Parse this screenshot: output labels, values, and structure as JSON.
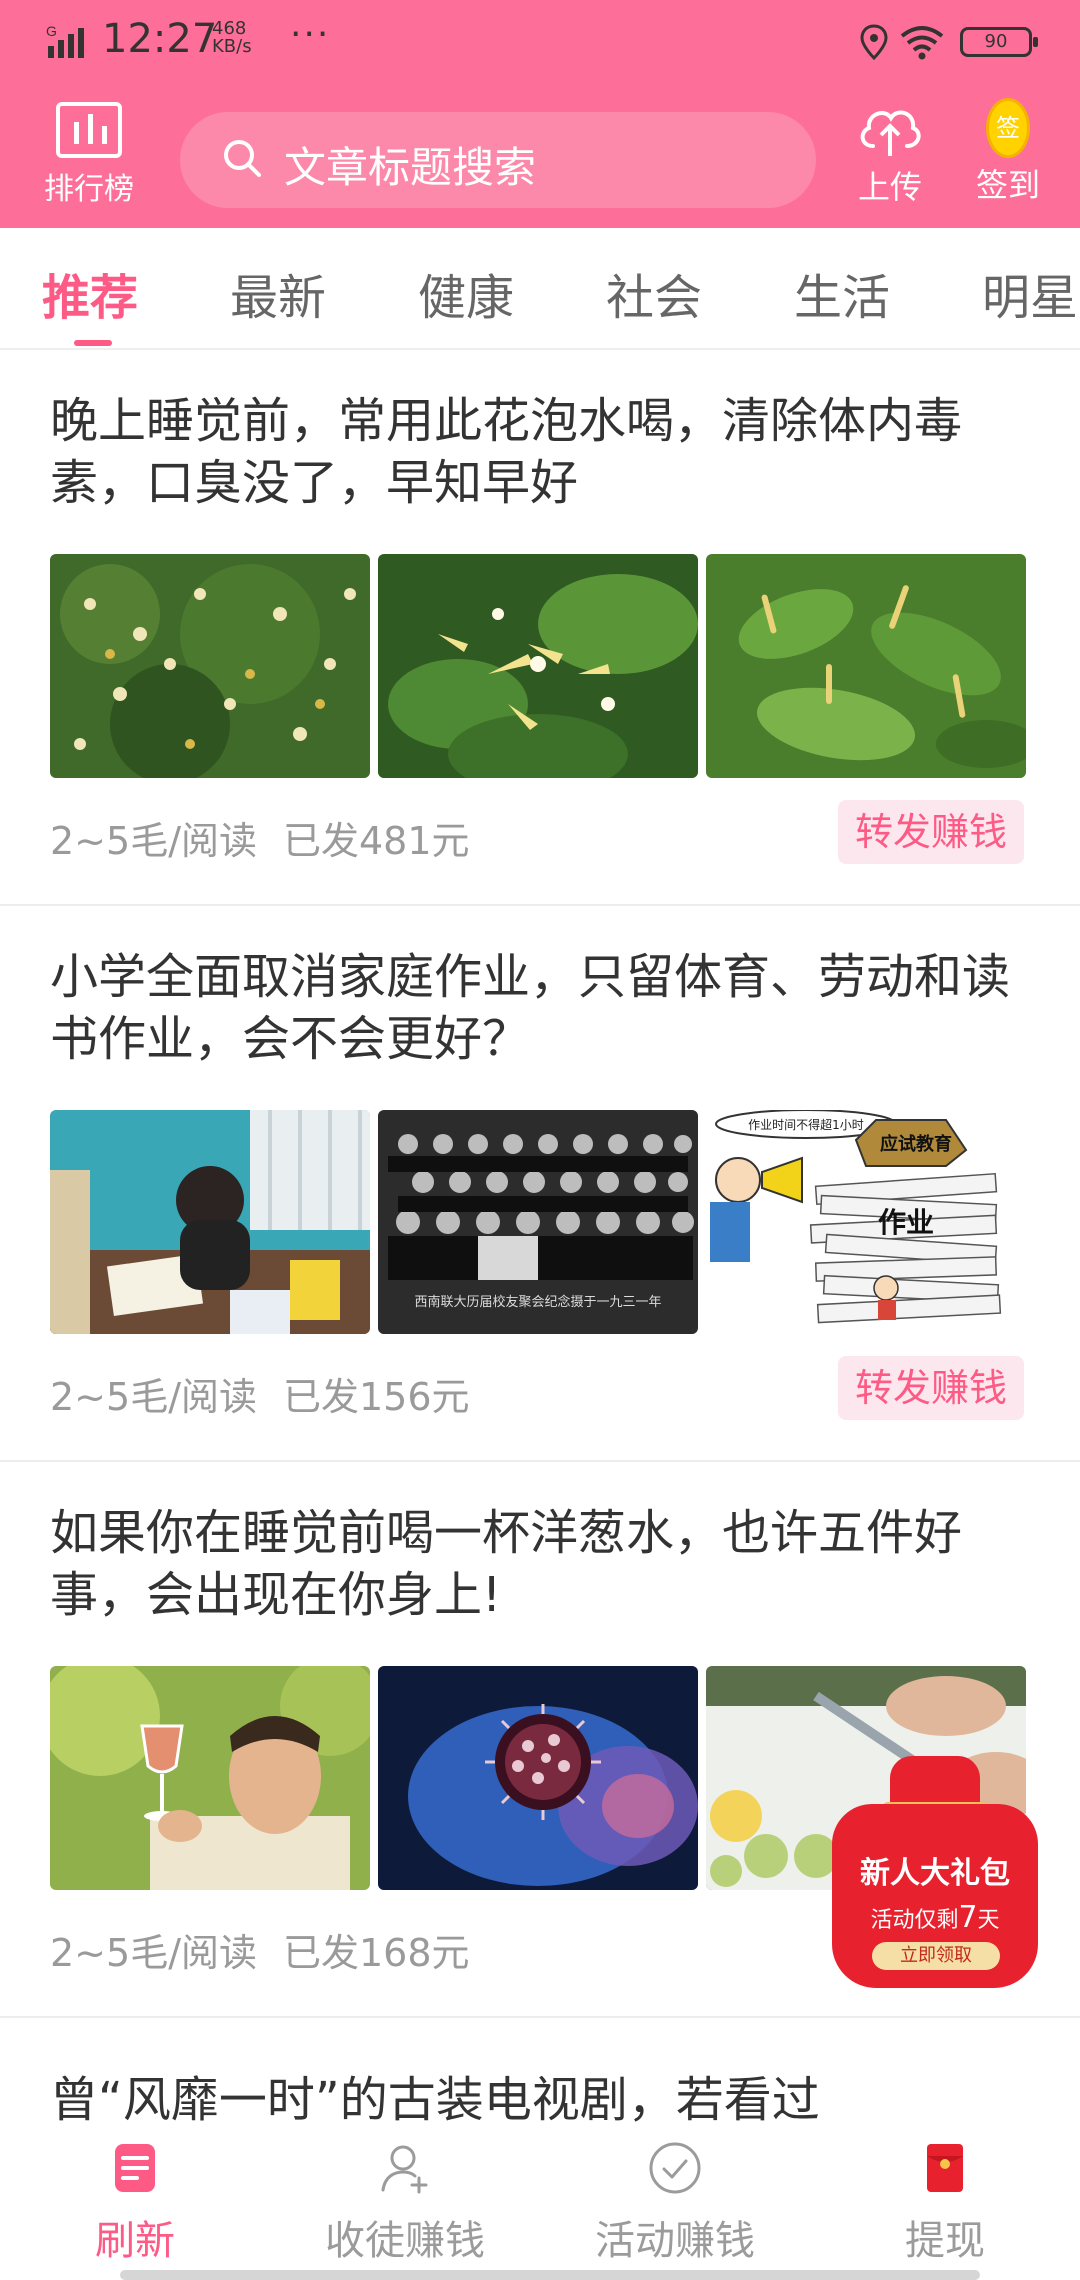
{
  "status_bar": {
    "time": "12:27",
    "net_speed_value": "468",
    "net_speed_unit": "KB/s",
    "more": "···",
    "battery": "90"
  },
  "header": {
    "rank_label": "排行榜",
    "search_placeholder": "文章标题搜索",
    "upload_label": "上传",
    "checkin_label": "签到",
    "checkin_coin": "签"
  },
  "tabs": [
    {
      "label": "推荐",
      "active": true
    },
    {
      "label": "最新"
    },
    {
      "label": "健康"
    },
    {
      "label": "社会"
    },
    {
      "label": "生活"
    },
    {
      "label": "明星"
    }
  ],
  "articles": [
    {
      "title": "晚上睡觉前，常用此花泡水喝，清除体内毒素，口臭没了，早知早好",
      "rate": "2~5毛/阅读",
      "paid": "已发481元",
      "share": "转发赚钱",
      "thumbs": [
        "honeysuckle-bush-image",
        "honeysuckle-closeup-image",
        "honeysuckle-leaves-image"
      ]
    },
    {
      "title": "小学全面取消家庭作业，只留体育、劳动和读书作业，会不会更好？",
      "rate": "2~5毛/阅读",
      "paid": "已发156元",
      "share": "转发赚钱",
      "thumbs": [
        "child-writing-image",
        "group-photo-image",
        "homework-cartoon-image"
      ],
      "cartoon_text": {
        "speech": "作业时间不得超1小时",
        "hat": "应试教育",
        "pile": "作业"
      },
      "photo_caption": "西南联大历届校友聚会纪念摄于一九三一年"
    },
    {
      "title": "如果你在睡觉前喝一杯洋葱水，也许五件好事，会出现在你身上!",
      "rate": "2~5毛/阅读",
      "paid": "已发168元",
      "thumbs": [
        "man-with-drink-image",
        "virus-cell-image",
        "cutting-vegetables-image"
      ]
    }
  ],
  "partial_title": "曾“风靡一时”的古装电视剧，若看过",
  "gift_popup": {
    "title": "新人大礼包",
    "line_prefix": "活动仅剩",
    "days": "7",
    "line_suffix": "天",
    "button": "立即领取"
  },
  "bottom_nav": [
    {
      "label": "刷新",
      "icon": "refresh-doc-icon",
      "active": true
    },
    {
      "label": "收徒赚钱",
      "icon": "person-add-icon"
    },
    {
      "label": "活动赚钱",
      "icon": "check-circle-icon"
    },
    {
      "label": "提现",
      "icon": "red-envelope-icon"
    }
  ],
  "colors": {
    "brand_pink": "#fd6f98",
    "accent": "#fd5b86",
    "share_bg": "#fde7ee",
    "gift_red": "#e8212e"
  }
}
